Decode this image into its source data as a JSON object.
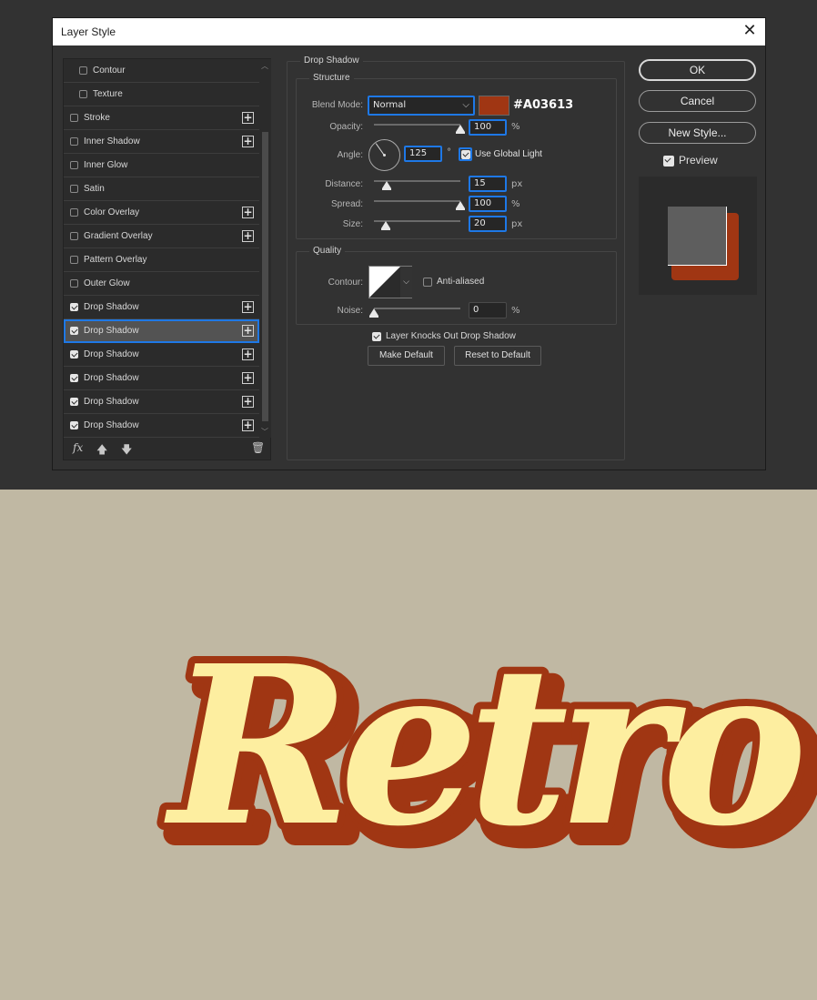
{
  "dialog": {
    "title": "Layer Style",
    "close": "✕"
  },
  "style_list": [
    {
      "label": "Contour",
      "checked": false,
      "plus": false,
      "indent": true
    },
    {
      "label": "Texture",
      "checked": false,
      "plus": false,
      "indent": true
    },
    {
      "label": "Stroke",
      "checked": false,
      "plus": true
    },
    {
      "label": "Inner Shadow",
      "checked": false,
      "plus": true
    },
    {
      "label": "Inner Glow",
      "checked": false,
      "plus": false
    },
    {
      "label": "Satin",
      "checked": false,
      "plus": false
    },
    {
      "label": "Color Overlay",
      "checked": false,
      "plus": true
    },
    {
      "label": "Gradient Overlay",
      "checked": false,
      "plus": true
    },
    {
      "label": "Pattern Overlay",
      "checked": false,
      "plus": false
    },
    {
      "label": "Outer Glow",
      "checked": false,
      "plus": false
    },
    {
      "label": "Drop Shadow",
      "checked": true,
      "plus": true
    },
    {
      "label": "Drop Shadow",
      "checked": true,
      "plus": true,
      "selected": true
    },
    {
      "label": "Drop Shadow",
      "checked": true,
      "plus": true
    },
    {
      "label": "Drop Shadow",
      "checked": true,
      "plus": true
    },
    {
      "label": "Drop Shadow",
      "checked": true,
      "plus": true
    },
    {
      "label": "Drop Shadow",
      "checked": true,
      "plus": true
    }
  ],
  "list_footer": {
    "fx": "fx",
    "up": "🡅",
    "down": "🡇",
    "trash": "🗑"
  },
  "drop_shadow": {
    "group_title": "Drop Shadow",
    "structure_title": "Structure",
    "blend_mode_label": "Blend Mode:",
    "blend_mode": "Normal",
    "shadow_color": "#A03613",
    "color_hex_label": "#A03613",
    "opacity_label": "Opacity:",
    "opacity": "100",
    "percent": "%",
    "angle_label": "Angle:",
    "angle": "125",
    "degree": "°",
    "use_global_light": "Use Global Light",
    "distance_label": "Distance:",
    "distance": "15",
    "spread_label": "Spread:",
    "spread": "100",
    "size_label": "Size:",
    "size": "20",
    "px": "px",
    "quality_title": "Quality",
    "contour_label": "Contour:",
    "anti_aliased": "Anti-aliased",
    "noise_label": "Noise:",
    "noise": "0",
    "layer_knocks_out": "Layer Knocks Out Drop Shadow",
    "make_default": "Make Default",
    "reset_default": "Reset to Default",
    "slider_levels": {
      "opacity": 1.0,
      "distance": 0.15,
      "spread": 1.0,
      "size": 0.14,
      "noise": 0.0
    }
  },
  "right_panel": {
    "ok": "OK",
    "cancel": "Cancel",
    "new_style": "New Style...",
    "preview": "Preview"
  },
  "canvas": {
    "text": "Retro",
    "fill_color": "#fdeea0",
    "stroke_color": "#a03613",
    "background": "#c0b8a3"
  }
}
